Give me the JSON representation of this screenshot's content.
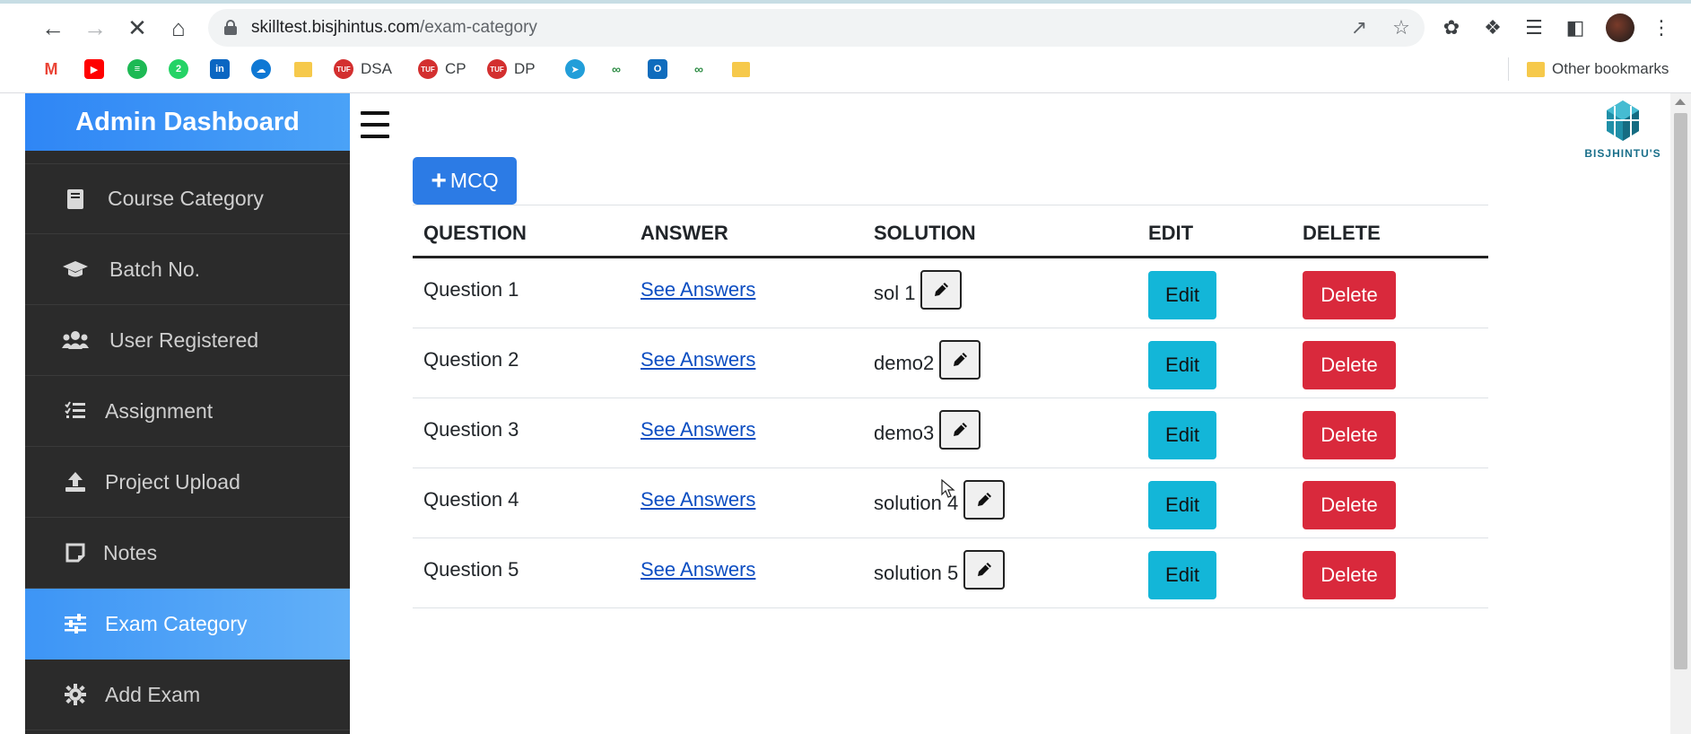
{
  "browser": {
    "url_host": "skilltest.bisjhintus.com",
    "url_path": "/exam-category",
    "bookmarks": [
      {
        "icon": "gmail-icon",
        "label": "",
        "color": "#ea4335"
      },
      {
        "icon": "youtube-icon",
        "label": "",
        "color": "#ff0000"
      },
      {
        "icon": "spotify-icon",
        "label": "",
        "color": "#1db954"
      },
      {
        "icon": "whatsapp-icon",
        "label": "",
        "color": "#25d366"
      },
      {
        "icon": "linkedin-icon",
        "label": "",
        "color": "#0a66c2"
      },
      {
        "icon": "onedrive-icon",
        "label": "",
        "color": "#0f78d4"
      },
      {
        "icon": "folder-icon",
        "label": "",
        "color": "#f6c94b"
      },
      {
        "icon": "tuf-icon",
        "label": "DSA",
        "color": "#d32f2f"
      },
      {
        "icon": "tuf-icon",
        "label": "CP",
        "color": "#d32f2f"
      },
      {
        "icon": "tuf-icon",
        "label": "DP",
        "color": "#d32f2f"
      },
      {
        "icon": "telegram-icon",
        "label": "",
        "color": "#229ed9"
      },
      {
        "icon": "geeksforgeeks-icon",
        "label": "",
        "color": "#2f8d46"
      },
      {
        "icon": "outlook-icon",
        "label": "",
        "color": "#0f6cbd"
      },
      {
        "icon": "geeksforgeeks-icon",
        "label": "",
        "color": "#2f8d46"
      },
      {
        "icon": "folder-icon",
        "label": "",
        "color": "#f6c94b"
      }
    ],
    "other_bookmarks": "Other bookmarks"
  },
  "sidebar": {
    "title": "Admin Dashboard",
    "items": [
      {
        "label": "Course Category",
        "icon": "book-icon"
      },
      {
        "label": "Batch No.",
        "icon": "graduation-cap-icon"
      },
      {
        "label": "User Registered",
        "icon": "users-icon"
      },
      {
        "label": "Assignment",
        "icon": "tasks-icon"
      },
      {
        "label": "Project Upload",
        "icon": "upload-icon"
      },
      {
        "label": "Notes",
        "icon": "note-icon"
      },
      {
        "label": "Exam Category",
        "icon": "sliders-icon",
        "active": true
      },
      {
        "label": "Add Exam",
        "icon": "gear-icon"
      }
    ]
  },
  "main": {
    "brand": "BISJHINTU'S",
    "add_button_label": "MCQ",
    "table": {
      "headers": [
        "QUESTION",
        "ANSWER",
        "SOLUTION",
        "EDIT",
        "DELETE"
      ],
      "rows": [
        {
          "question": "Question 1",
          "answer_link": "See Answers",
          "solution": "sol 1",
          "edit": "Edit",
          "delete": "Delete"
        },
        {
          "question": "Question 2",
          "answer_link": "See Answers",
          "solution": "demo2",
          "edit": "Edit",
          "delete": "Delete"
        },
        {
          "question": "Question 3",
          "answer_link": "See Answers",
          "solution": "demo3",
          "edit": "Edit",
          "delete": "Delete"
        },
        {
          "question": "Question 4",
          "answer_link": "See Answers",
          "solution": "solution 4",
          "edit": "Edit",
          "delete": "Delete"
        },
        {
          "question": "Question 5",
          "answer_link": "See Answers",
          "solution": "solution 5",
          "edit": "Edit",
          "delete": "Delete"
        }
      ]
    }
  },
  "colors": {
    "sidebar_bg": "#2b2b2b",
    "accent_blue": "#2c7be5",
    "edit_button": "#13b6d8",
    "delete_button": "#d9293c",
    "link": "#0d4ec2"
  }
}
